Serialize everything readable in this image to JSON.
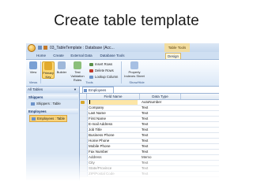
{
  "slide": {
    "title": "Create table template"
  },
  "window": {
    "title": "03_TableTemplate : Database (Acc...",
    "context_tab": "Table Tools"
  },
  "ribbon": {
    "tabs": [
      "Home",
      "Create",
      "External Data",
      "Database Tools",
      "Design"
    ],
    "active_tab": "Design",
    "buttons": {
      "view": "View",
      "primary_key": "Primary Key",
      "builder": "Builder",
      "test_validation": "Test Validation Rules",
      "property_sheet": "Property Indexes Sheet"
    },
    "small_commands": [
      "Insert Rows",
      "Delete Rows",
      "Lookup Column"
    ],
    "groups": {
      "views": "Views",
      "tools": "Tools",
      "show_hide": "Show/Hide"
    }
  },
  "nav": {
    "header": "All Tables",
    "groups": [
      {
        "name": "Shippers",
        "items": [
          "Shippers : Table"
        ]
      },
      {
        "name": "Employees",
        "items": [
          "Employees : Table"
        ]
      }
    ]
  },
  "document": {
    "tab_label": "Employees",
    "columns": {
      "field": "Field Name",
      "type": "Data Type"
    },
    "rows": [
      {
        "field": "",
        "type": "AutoNumber"
      },
      {
        "field": "Company",
        "type": "Text"
      },
      {
        "field": "Last Name",
        "type": "Text"
      },
      {
        "field": "First Name",
        "type": "Text"
      },
      {
        "field": "E-mail Address",
        "type": "Text"
      },
      {
        "field": "Job Title",
        "type": "Text"
      },
      {
        "field": "Business Phone",
        "type": "Text"
      },
      {
        "field": "Home Phone",
        "type": "Text"
      },
      {
        "field": "Mobile Phone",
        "type": "Text"
      },
      {
        "field": "Fax Number",
        "type": "Text"
      },
      {
        "field": "Address",
        "type": "Memo"
      },
      {
        "field": "City",
        "type": "Text"
      },
      {
        "field": "State/Province",
        "type": "Text"
      },
      {
        "field": "ZIP/Postal Code",
        "type": "Text"
      }
    ]
  },
  "colors": {
    "ribbon_blue": "#cfdff2",
    "highlight": "#fbd776",
    "nav_bg": "#d9e6f5"
  }
}
